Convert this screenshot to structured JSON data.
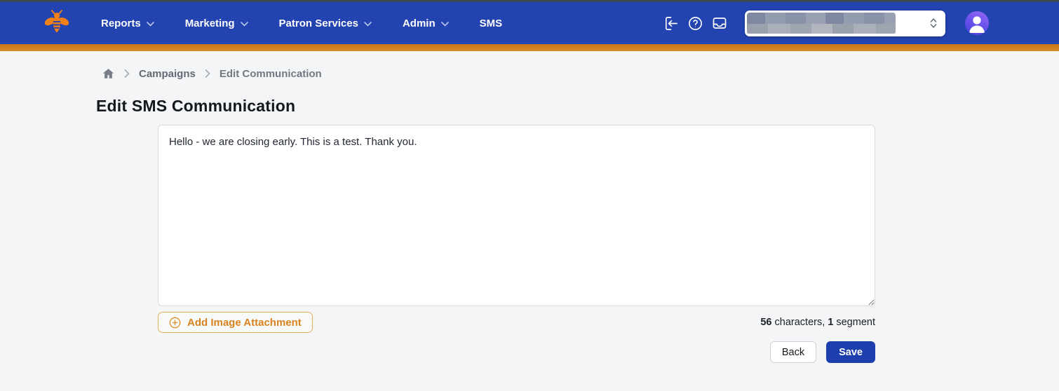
{
  "nav": {
    "items": [
      {
        "label": "Reports",
        "has_dropdown": true
      },
      {
        "label": "Marketing",
        "has_dropdown": true
      },
      {
        "label": "Patron Services",
        "has_dropdown": true
      },
      {
        "label": "Admin",
        "has_dropdown": true
      },
      {
        "label": "SMS",
        "has_dropdown": false
      }
    ],
    "icons": [
      "logout-icon",
      "help-icon",
      "inbox-icon"
    ],
    "account_select": {
      "value": "",
      "redacted": true
    }
  },
  "breadcrumb": {
    "items": [
      "Campaigns",
      "Edit Communication"
    ]
  },
  "page": {
    "title": "Edit SMS Communication"
  },
  "form": {
    "message_value": "Hello - we are closing early. This is a test. Thank you.",
    "add_image_label": "Add Image Attachment",
    "char_count": "56",
    "characters_label": " characters, ",
    "segment_count": "1",
    "segment_label": " segment",
    "back_label": "Back",
    "save_label": "Save"
  },
  "colors": {
    "navbar": "#2243b0",
    "accent_orange": "#cd7d1e",
    "save_blue": "#1d3fae",
    "brand_orange": "#f08018",
    "background": "#f4f5f6"
  }
}
